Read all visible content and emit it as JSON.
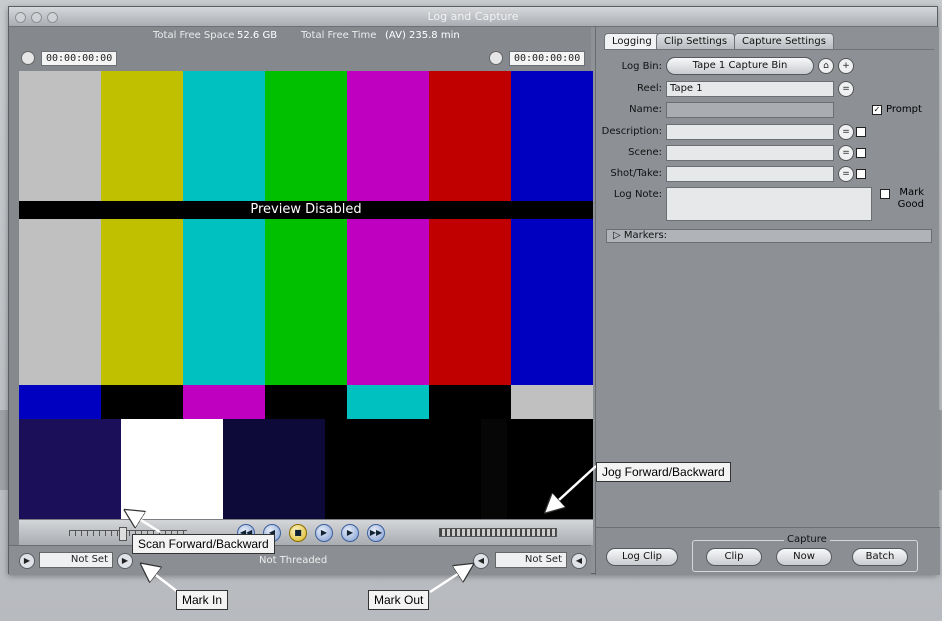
{
  "window": {
    "title": "Log and Capture"
  },
  "viewer": {
    "free_space_label": "Total Free Space",
    "free_space_value": "52.6 GB",
    "free_time_label": "Total Free Time",
    "free_time_value": "(AV) 235.8 min",
    "timecode_left": "00:00:00:00",
    "timecode_right": "00:00:00:00",
    "preview_text": "Preview Disabled",
    "colors": {
      "top": [
        "#c0c0c0",
        "#c0c000",
        "#00c0c0",
        "#00c000",
        "#c000c0",
        "#c00000",
        "#0000c0"
      ],
      "middle": [
        "#0000c0",
        "#000000",
        "#c000c0",
        "#000000",
        "#00c0c0",
        "#000000",
        "#c0c0c0"
      ],
      "bottom": [
        "#1c0f5a",
        "#ffffff",
        "#0d0a3a",
        "#000000",
        "#060606",
        "#000000"
      ]
    }
  },
  "bottom_left": {
    "in_value": "Not Set",
    "out_value": "Not Set",
    "threaded": "Not Threaded"
  },
  "tabs": [
    "Logging",
    "Clip Settings",
    "Capture Settings"
  ],
  "logging": {
    "log_bin_label": "Log Bin:",
    "log_bin_value": "Tape 1 Capture Bin",
    "reel_label": "Reel:",
    "reel_value": "Tape 1",
    "name_label": "Name:",
    "prompt_label": "Prompt",
    "description_label": "Description:",
    "scene_label": "Scene:",
    "shot_label": "Shot/Take:",
    "lognote_label": "Log Note:",
    "mark_good_label": "Mark Good",
    "markers_label": "Markers:"
  },
  "capture": {
    "log_clip": "Log Clip",
    "group_title": "Capture",
    "clip": "Clip",
    "now": "Now",
    "batch": "Batch"
  },
  "annotations": {
    "jog": "Jog Forward/Backward",
    "scan": "Scan Forward/Backward",
    "mark_in": "Mark In",
    "mark_out": "Mark Out"
  }
}
